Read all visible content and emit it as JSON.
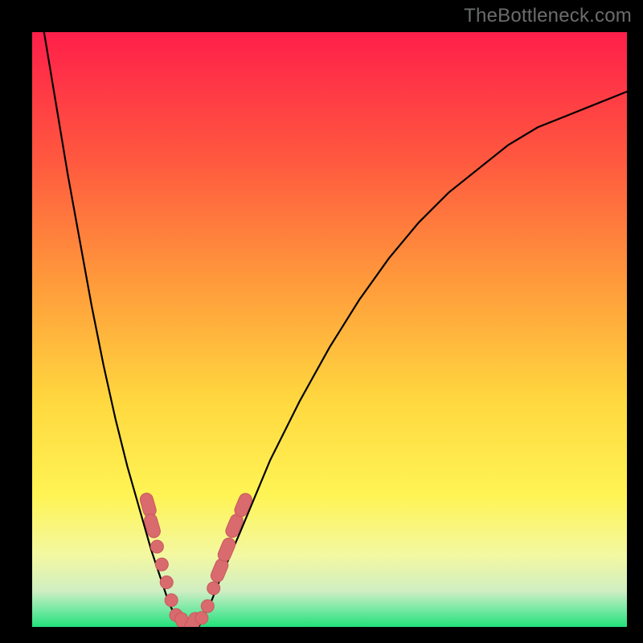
{
  "watermark": "TheBottleneck.com",
  "colors": {
    "bg_black": "#000000",
    "grad_top": "#ff1f4a",
    "grad_mid1": "#ff6a3d",
    "grad_mid2": "#ffb23a",
    "grad_mid3": "#ffe547",
    "grad_mid4": "#f7f98d",
    "grad_low": "#eef6b0",
    "grad_green": "#23e07a",
    "curve": "#000000",
    "marker_fill": "#d96a6d",
    "marker_stroke": "#c65a5d"
  },
  "chart_data": {
    "type": "line",
    "title": "",
    "xlabel": "",
    "ylabel": "",
    "xlim": [
      0,
      100
    ],
    "ylim": [
      0,
      100
    ],
    "grid": false,
    "legend": false,
    "series": [
      {
        "name": "left-curve",
        "x": [
          2,
          4,
          6,
          8,
          10,
          12,
          14,
          16,
          18,
          20,
          21,
          22,
          23,
          24,
          25
        ],
        "y": [
          100,
          88,
          76,
          65,
          54,
          44,
          35,
          27,
          20,
          13,
          10,
          7,
          4,
          2,
          0
        ]
      },
      {
        "name": "right-curve",
        "x": [
          28,
          30,
          32,
          35,
          40,
          45,
          50,
          55,
          60,
          65,
          70,
          75,
          80,
          85,
          90,
          95,
          100
        ],
        "y": [
          0,
          4,
          9,
          16,
          28,
          38,
          47,
          55,
          62,
          68,
          73,
          77,
          81,
          84,
          86,
          88,
          90
        ]
      }
    ],
    "markers": [
      {
        "x": 19.5,
        "y": 20.5,
        "shape": "rounded"
      },
      {
        "x": 20.2,
        "y": 17.0,
        "shape": "rounded"
      },
      {
        "x": 21.0,
        "y": 13.5,
        "shape": "round"
      },
      {
        "x": 21.8,
        "y": 10.5,
        "shape": "round"
      },
      {
        "x": 22.6,
        "y": 7.5,
        "shape": "round"
      },
      {
        "x": 23.4,
        "y": 4.5,
        "shape": "round"
      },
      {
        "x": 24.2,
        "y": 2.0,
        "shape": "round"
      },
      {
        "x": 25.5,
        "y": 0.5,
        "shape": "rounded"
      },
      {
        "x": 27.0,
        "y": 0.5,
        "shape": "rounded"
      },
      {
        "x": 28.5,
        "y": 1.5,
        "shape": "round"
      },
      {
        "x": 29.5,
        "y": 3.5,
        "shape": "round"
      },
      {
        "x": 30.5,
        "y": 6.5,
        "shape": "round"
      },
      {
        "x": 31.5,
        "y": 9.5,
        "shape": "rounded"
      },
      {
        "x": 32.7,
        "y": 13.0,
        "shape": "rounded"
      },
      {
        "x": 34.0,
        "y": 17.0,
        "shape": "rounded"
      },
      {
        "x": 35.5,
        "y": 20.5,
        "shape": "rounded"
      }
    ]
  }
}
